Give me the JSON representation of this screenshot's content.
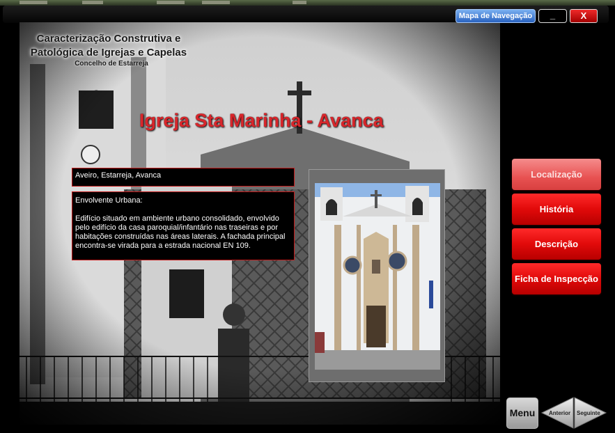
{
  "topbar": {
    "map_label": "Mapa de Navegação",
    "minimize_label": "_",
    "close_label": "X"
  },
  "header": {
    "title": "Caracterização Construtiva e Patológica de Igrejas e Capelas",
    "subtitle": "Concelho de Estarreja"
  },
  "church": {
    "name": "Igreja Sta Marinha - Avanca",
    "location": "Aveiro, Estarreja, Avanca",
    "env_heading": "Envolvente Urbana:",
    "env_text": "Edifício situado em ambiente urbano consolidado, envolvido pelo edifício da casa paroquial/infantário nas traseiras e por habitações construídas nas áreas laterais. A fachada principal encontra-se virada para a estrada nacional EN 109."
  },
  "side_menu": {
    "items": [
      {
        "label": "Localização",
        "state": "active"
      },
      {
        "label": "História",
        "state": "normal"
      },
      {
        "label": "Descrição",
        "state": "normal"
      },
      {
        "label": "Ficha de Inspecção",
        "state": "normal"
      }
    ]
  },
  "footer": {
    "menu_label": "Menu",
    "prev_label": "Anterior",
    "next_label": "Seguinte"
  },
  "colors": {
    "accent_red": "#d8262b",
    "active_button": "#e85252",
    "button_red": "#e10a0a",
    "map_button_blue": "#2a63c0"
  }
}
